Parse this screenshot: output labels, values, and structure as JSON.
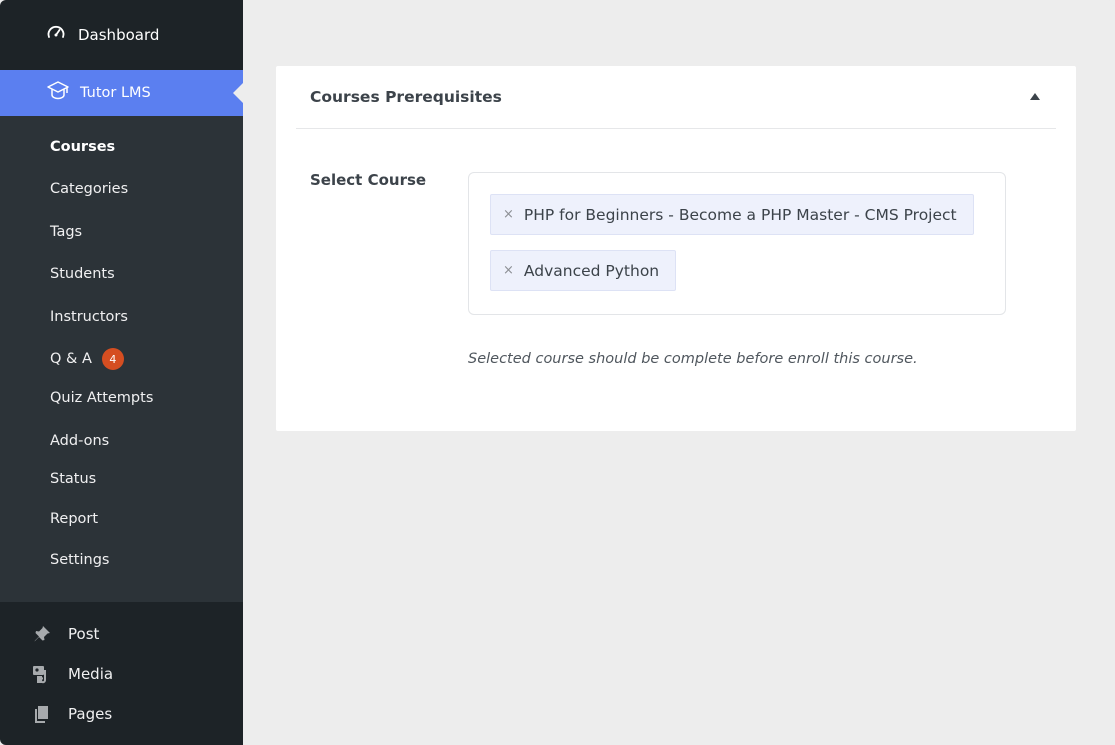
{
  "sidebar": {
    "dashboard_label": "Dashboard",
    "active_label": "Tutor LMS",
    "submenu": [
      {
        "label": "Courses"
      },
      {
        "label": "Categories"
      },
      {
        "label": "Tags"
      },
      {
        "label": "Students"
      },
      {
        "label": "Instructors"
      },
      {
        "label": "Q & A",
        "badge": "4"
      },
      {
        "label": "Quiz Attempts"
      },
      {
        "label": "Add-ons"
      },
      {
        "label": "Status"
      },
      {
        "label": "Report"
      },
      {
        "label": "Settings"
      }
    ],
    "bottom": [
      {
        "label": "Post",
        "icon": "pin-icon"
      },
      {
        "label": "Media",
        "icon": "media-icon"
      },
      {
        "label": "Pages",
        "icon": "pages-icon"
      }
    ]
  },
  "card": {
    "title": "Courses Prerequisites",
    "field_label": "Select Course",
    "selected_courses": [
      "PHP for Beginners - Become a PHP Master - CMS Project",
      "Advanced Python"
    ],
    "remove_glyph": "×",
    "help_text": "Selected course should be complete before enroll this course."
  },
  "colors": {
    "sidebar_bg": "#1d2327",
    "submenu_bg": "#2c3338",
    "accent": "#5b7ff0",
    "badge": "#d54e21"
  }
}
